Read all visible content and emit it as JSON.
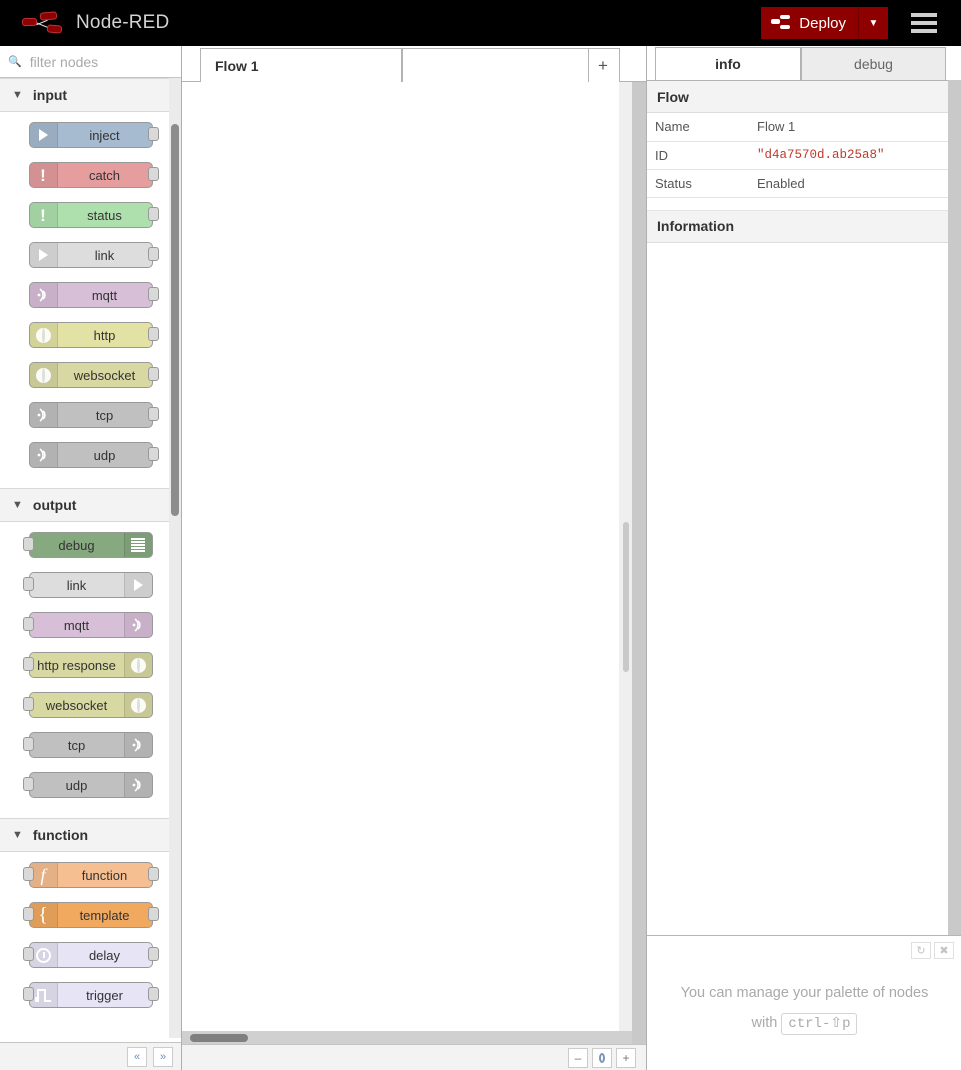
{
  "header": {
    "app_title": "Node-RED",
    "deploy_label": "Deploy",
    "deploy_color": "#8e0000",
    "deploy_dropdown_icon": "chevron-down-icon",
    "menu_icon": "hamburger-menu-icon",
    "logo_icon": "node-red-logo-icon"
  },
  "palette": {
    "search_placeholder": "filter nodes",
    "search_value": "",
    "search_icon": "search-icon",
    "collapse_all_label": "«",
    "expand_all_label": "»",
    "categories": [
      {
        "name": "input",
        "collapsed": false,
        "nodes": [
          {
            "label": "inject",
            "color": "#a6bbcf",
            "icon": "inject-arrow-icon",
            "icon_side": "left",
            "ports": [
              "out"
            ]
          },
          {
            "label": "catch",
            "color": "#e59d9d",
            "icon": "alert-bang-icon",
            "icon_side": "left",
            "ports": [
              "out"
            ]
          },
          {
            "label": "status",
            "color": "#aee0ae",
            "icon": "alert-bang-icon",
            "icon_side": "left",
            "ports": [
              "out"
            ]
          },
          {
            "label": "link",
            "color": "#dddddd",
            "icon": "link-arrow-icon",
            "icon_side": "left",
            "ports": [
              "out"
            ]
          },
          {
            "label": "mqtt",
            "color": "#d8bfd8",
            "icon": "broadcast-icon",
            "icon_side": "left",
            "ports": [
              "out"
            ]
          },
          {
            "label": "http",
            "color": "#e2e2a5",
            "icon": "globe-icon",
            "icon_side": "left",
            "ports": [
              "out"
            ]
          },
          {
            "label": "websocket",
            "color": "#d8d8a2",
            "icon": "globe-icon",
            "icon_side": "left",
            "ports": [
              "out"
            ]
          },
          {
            "label": "tcp",
            "color": "#c0c0c0",
            "icon": "broadcast-icon",
            "icon_side": "left",
            "ports": [
              "out"
            ]
          },
          {
            "label": "udp",
            "color": "#c0c0c0",
            "icon": "broadcast-icon",
            "icon_side": "left",
            "ports": [
              "out"
            ]
          }
        ]
      },
      {
        "name": "output",
        "collapsed": false,
        "nodes": [
          {
            "label": "debug",
            "color": "#87a980",
            "icon": "debug-lines-icon",
            "icon_side": "right",
            "ports": [
              "in"
            ]
          },
          {
            "label": "link",
            "color": "#dddddd",
            "icon": "link-arrow-icon",
            "icon_side": "right",
            "ports": [
              "in"
            ]
          },
          {
            "label": "mqtt",
            "color": "#d8bfd8",
            "icon": "broadcast-icon",
            "icon_side": "right",
            "ports": [
              "in"
            ]
          },
          {
            "label": "http response",
            "color": "#d8d8a2",
            "icon": "globe-icon",
            "icon_side": "right",
            "ports": [
              "in"
            ]
          },
          {
            "label": "websocket",
            "color": "#d8d8a2",
            "icon": "globe-icon",
            "icon_side": "right",
            "ports": [
              "in"
            ]
          },
          {
            "label": "tcp",
            "color": "#c0c0c0",
            "icon": "broadcast-icon",
            "icon_side": "right",
            "ports": [
              "in"
            ]
          },
          {
            "label": "udp",
            "color": "#c0c0c0",
            "icon": "broadcast-icon",
            "icon_side": "right",
            "ports": [
              "in"
            ]
          }
        ]
      },
      {
        "name": "function",
        "collapsed": false,
        "nodes": [
          {
            "label": "function",
            "color": "#f6bf92",
            "icon": "function-f-icon",
            "icon_side": "left",
            "ports": [
              "in",
              "out"
            ]
          },
          {
            "label": "template",
            "color": "#f0a95f",
            "icon": "curly-brace-icon",
            "icon_side": "left",
            "ports": [
              "in",
              "out"
            ]
          },
          {
            "label": "delay",
            "color": "#e7e4f5",
            "icon": "clock-icon",
            "icon_side": "left",
            "ports": [
              "in",
              "out"
            ]
          },
          {
            "label": "trigger",
            "color": "#e7e4f5",
            "icon": "pulse-icon",
            "icon_side": "left",
            "ports": [
              "in",
              "out"
            ]
          }
        ]
      }
    ]
  },
  "workspace": {
    "tabs": [
      {
        "label": "Flow 1",
        "active": true
      }
    ],
    "add_tab_icon": "plus-icon",
    "zoom_out_icon": "minus-icon",
    "zoom_reset_icon": "circle-icon",
    "zoom_in_icon": "plus-icon"
  },
  "sidebar": {
    "tabs": [
      {
        "label": "info",
        "active": true
      },
      {
        "label": "debug",
        "active": false
      }
    ],
    "flow_section_title": "Flow",
    "properties": [
      {
        "key": "Name",
        "value": "Flow 1",
        "mono": false
      },
      {
        "key": "ID",
        "value": "\"d4a7570d.ab25a8\"",
        "mono": true
      },
      {
        "key": "Status",
        "value": "Enabled",
        "mono": false
      }
    ],
    "information_title": "Information",
    "tip": {
      "text_before": "You can manage your palette of nodes",
      "text_with": "with",
      "shortcut": "ctrl-⇧p",
      "refresh_icon": "refresh-icon",
      "close_icon": "close-icon"
    }
  }
}
